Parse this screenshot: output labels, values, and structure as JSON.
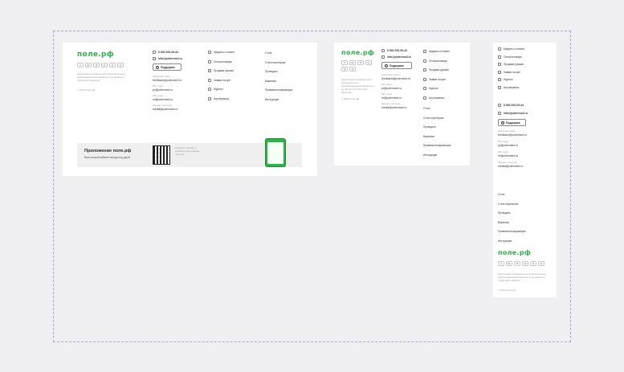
{
  "logo": "поле.рф",
  "socials": [
    "тг",
    "вк",
    "✉",
    "vc",
    "●",
    "◎"
  ],
  "tagline": "Настоящая страница носит исключительно информационный характер и не является публичной офертой",
  "copyright": "© 2024 поле.рф",
  "phone": "8 800 200-09-44",
  "email": "info@polervsed.ru",
  "support_label": "Поддержка",
  "contacts": [
    {
      "label": "Обратная связь",
      "value": "feedback@polervsed.ru"
    },
    {
      "label": "PR-отдел",
      "value": "pr@polervsed.ru"
    },
    {
      "label": "HR-отдел",
      "value": "hr@polervsed.ru"
    },
    {
      "label": "Журнал поля.рф",
      "value": "media@polervsed.ru"
    }
  ],
  "menu": [
    "Кредиты и лизинг",
    "Сельхозтовары",
    "Продажа урожая",
    "Заявки на цен",
    "Журнал",
    "Агросервисы"
  ],
  "links": [
    "О нас",
    "Стать партнером",
    "Проводить",
    "Вакансии",
    "Правовая информация",
    "Инструкции"
  ],
  "app_banner": {
    "title": "Приложение поле.рф",
    "subtitle": "Ваш личный кабинет всегда под рукой",
    "qr_caption": "Наведите камеру и скачайте приложение поле.рф"
  },
  "colors": {
    "brand": "#2cb34a",
    "frame": "#a9a4d6",
    "background": "#f0eff1"
  }
}
